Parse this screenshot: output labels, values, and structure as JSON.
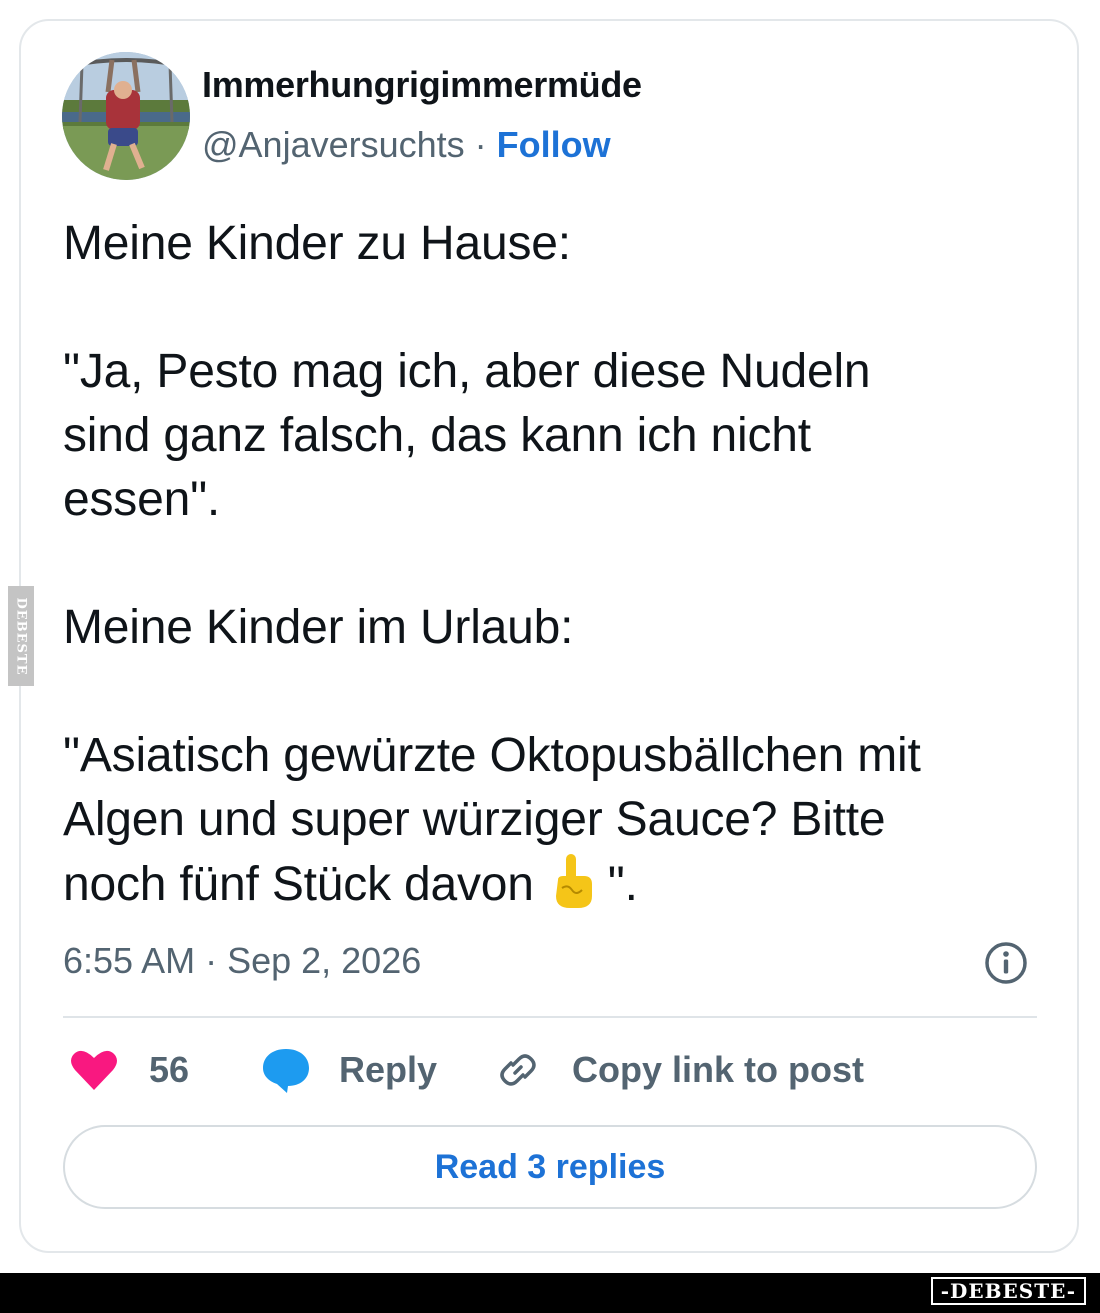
{
  "user": {
    "display_name": "Immerhungrigimmermüde",
    "handle": "@Anjaversuchts",
    "separator": " · ",
    "follow_label": "Follow"
  },
  "tweet": {
    "lines": [
      "Meine Kinder zu Hause:",
      "\"Ja, Pesto mag ich, aber diese Nudeln",
      "sind ganz falsch, das kann ich nicht",
      "essen\".",
      "Meine Kinder im Urlaub:",
      "\"Asiatisch gewürzte Oktopusbällchen mit",
      "Algen und super würziger Sauce? Bitte",
      "noch fünf Stück davon",
      "\"."
    ],
    "emoji": "pointing-up-hand-emoji"
  },
  "timestamp": "6:55 AM · Sep 2, 2026",
  "actions": {
    "like_count": "56",
    "reply_label": "Reply",
    "copy_label": "Copy link to post"
  },
  "read_replies_label": "Read 3 replies",
  "watermark": {
    "side_text": "DEBESTE",
    "footer_text": "-DEBESTE-"
  },
  "colors": {
    "accent": "#1d72d6",
    "like": "#f91880",
    "reply_icon": "#1d9bf0",
    "secondary_text": "#536471",
    "footer": "#000000"
  }
}
